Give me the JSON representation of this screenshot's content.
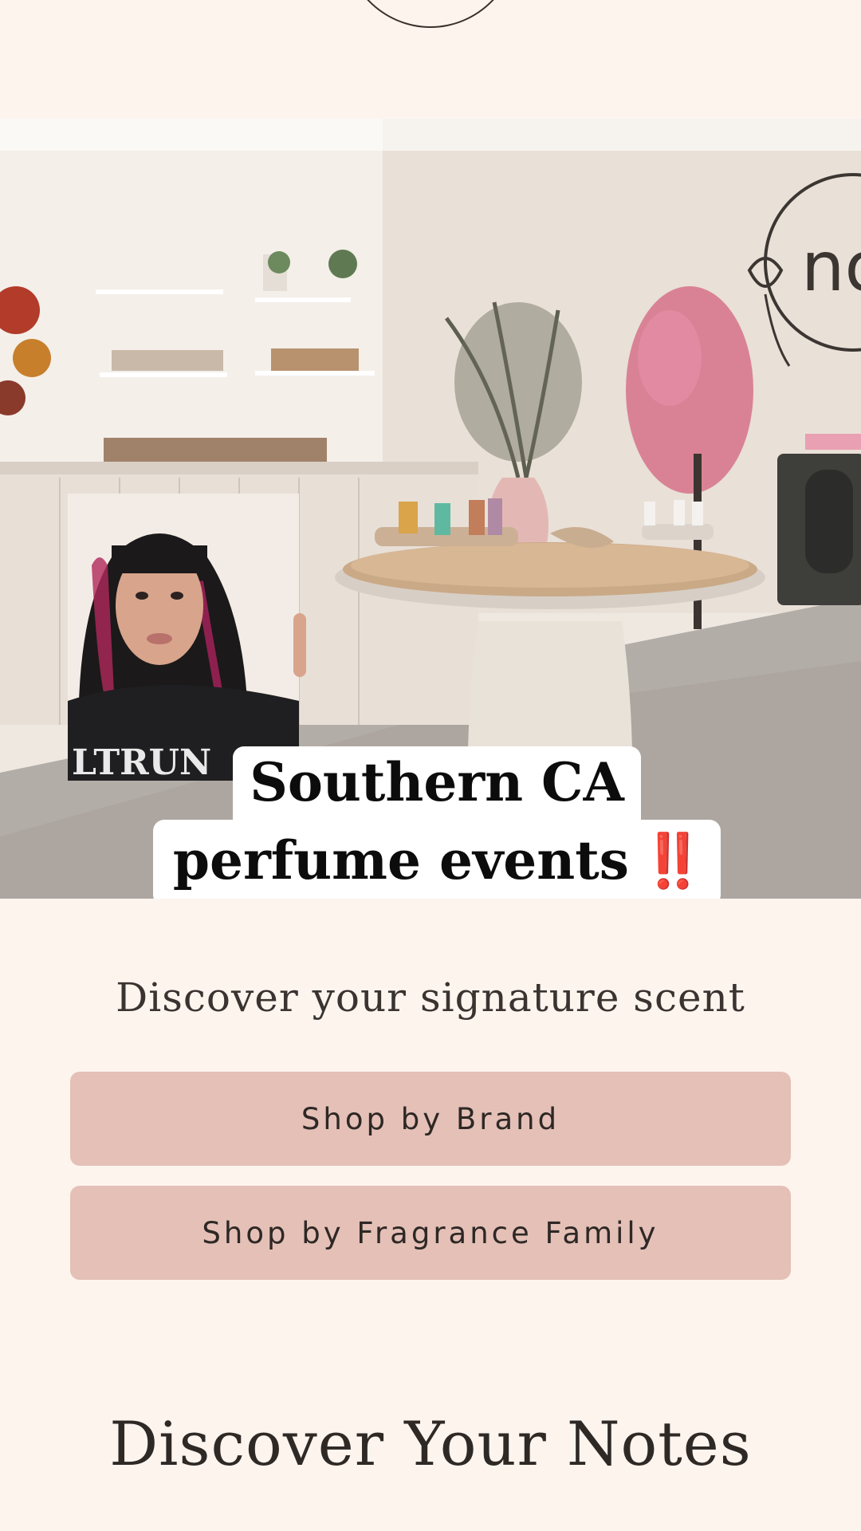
{
  "logo": {
    "label": "logo"
  },
  "hero": {
    "store_sign": "no",
    "caption_line1": "Southern CA",
    "caption_line2": "perfume events",
    "caption_emoji": "‼️"
  },
  "main": {
    "tagline": "Discover your signature scent",
    "buttons": [
      {
        "label": "Shop by Brand"
      },
      {
        "label": "Shop by Fragrance Family"
      }
    ],
    "section_title": "Discover Your Notes"
  },
  "colors": {
    "background": "#fdf4ee",
    "button": "#e4c0b7",
    "text": "#2f2926",
    "caption_accent": "#d8232a"
  }
}
